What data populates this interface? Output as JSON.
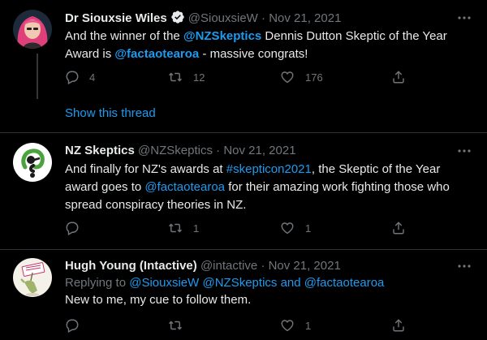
{
  "tweets": [
    {
      "name": "Dr Siouxsie Wiles",
      "handle": "@SiouxsieW",
      "dot": "·",
      "date": "Nov 21, 2021",
      "verified": true,
      "text_lines": [
        [
          {
            "t": "And the winner of the "
          },
          {
            "t": "@NZSkeptics",
            "link": true,
            "bold": true
          },
          {
            "t": " Dennis Dutton Skeptic of the Year"
          }
        ],
        [
          {
            "t": "Award is "
          },
          {
            "t": "@factaotearoa",
            "link": true,
            "bold": true
          },
          {
            "t": " - massive congrats!"
          }
        ]
      ],
      "replies": "4",
      "retweets": "12",
      "likes": "176",
      "show_thread": "Show this thread"
    },
    {
      "name": "NZ Skeptics",
      "handle": "@NZSkeptics",
      "dot": "·",
      "date": "Nov 21, 2021",
      "text_lines": [
        [
          {
            "t": "And finally for NZ's awards at "
          },
          {
            "t": "#skepticon2021",
            "link": true
          },
          {
            "t": ", the Skeptic of the Year"
          }
        ],
        [
          {
            "t": "award goes to "
          },
          {
            "t": "@factaotearoa",
            "link": true
          },
          {
            "t": " for their amazing work fighting those who"
          }
        ],
        [
          {
            "t": "spread conspiracy theories in NZ."
          }
        ]
      ],
      "replies": "",
      "retweets": "1",
      "likes": "1"
    },
    {
      "name": "Hugh Young (Intactive)",
      "handle": "@intactive",
      "dot": "·",
      "date": "Nov 21, 2021",
      "replying_prefix": "Replying to ",
      "replying_to": [
        {
          "t": "@SiouxsieW",
          "link": true
        },
        {
          "t": " "
        },
        {
          "t": "@NZSkeptics",
          "link": true
        },
        {
          "t": " and ",
          "link": true
        },
        {
          "t": "@factaotearoa",
          "link": true
        }
      ],
      "text_lines": [
        [
          {
            "t": "New to me, my cue to follow them."
          }
        ]
      ],
      "replies": "",
      "retweets": "",
      "likes": "1"
    }
  ],
  "icons": {
    "reply": "reply-icon",
    "retweet": "retweet-icon",
    "like": "heart-icon",
    "share": "share-icon",
    "more": "more-icon",
    "verified": "verified-badge-icon"
  },
  "colors": {
    "background": "#000000",
    "text": "#e7e9ea",
    "secondary": "#71767b",
    "link": "#1d9bf0",
    "divider": "#2f3336"
  }
}
